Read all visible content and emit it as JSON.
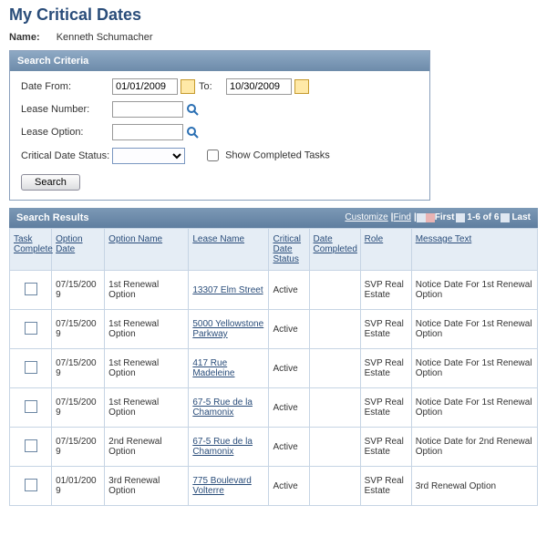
{
  "title": "My Critical Dates",
  "name_label": "Name:",
  "name_value": "Kenneth Schumacher",
  "search_panel": {
    "header": "Search Criteria",
    "date_from_label": "Date From:",
    "date_from_value": "01/01/2009",
    "to_label": "To:",
    "to_value": "10/30/2009",
    "lease_number_label": "Lease Number:",
    "lease_option_label": "Lease Option:",
    "status_label": "Critical Date Status:",
    "show_completed_label": "Show Completed Tasks",
    "search_button": "Search"
  },
  "results": {
    "header": "Search Results",
    "customize": "Customize",
    "find": "Find",
    "first": "First",
    "range": "1-6 of 6",
    "last": "Last",
    "cols": {
      "task": "Task Complete",
      "option_date": "Option Date",
      "option_name": "Option Name",
      "lease_name": "Lease Name",
      "status": "Critical Date Status",
      "date_completed": "Date Completed",
      "role": "Role",
      "message": "Message Text"
    },
    "rows": [
      {
        "option_date": "07/15/2009",
        "option_name": "1st Renewal Option",
        "lease_name": "13307 Elm Street",
        "status": "Active",
        "date_completed": "",
        "role": "SVP Real Estate",
        "message": "Notice Date For 1st Renewal Option"
      },
      {
        "option_date": "07/15/2009",
        "option_name": "1st Renewal Option",
        "lease_name": "5000 Yellowstone Parkway",
        "status": "Active",
        "date_completed": "",
        "role": "SVP Real Estate",
        "message": "Notice Date For 1st Renewal Option"
      },
      {
        "option_date": "07/15/2009",
        "option_name": "1st Renewal Option",
        "lease_name": "417 Rue Madeleine",
        "status": "Active",
        "date_completed": "",
        "role": "SVP Real Estate",
        "message": "Notice Date For 1st Renewal Option"
      },
      {
        "option_date": "07/15/2009",
        "option_name": "1st Renewal Option",
        "lease_name": "67-5 Rue de la Chamonix",
        "status": "Active",
        "date_completed": "",
        "role": "SVP Real Estate",
        "message": "Notice Date For 1st Renewal Option"
      },
      {
        "option_date": "07/15/2009",
        "option_name": "2nd Renewal Option",
        "lease_name": "67-5 Rue de la Chamonix",
        "status": "Active",
        "date_completed": "",
        "role": "SVP Real Estate",
        "message": "Notice Date for 2nd Renewal Option"
      },
      {
        "option_date": "01/01/2009",
        "option_name": "3rd Renewal Option",
        "lease_name": "775 Boulevard Volterre",
        "status": "Active",
        "date_completed": "",
        "role": "SVP Real Estate",
        "message": "3rd Renewal Option"
      }
    ]
  }
}
